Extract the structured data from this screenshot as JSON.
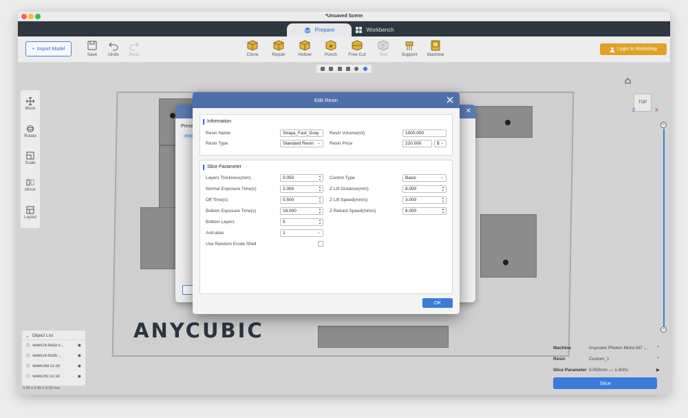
{
  "window": {
    "title": "*Unsaved Scene"
  },
  "tabs": [
    {
      "label": "Prepare"
    },
    {
      "label": "Workbench"
    }
  ],
  "toolbar": {
    "import_label": "Import Model",
    "left_items": [
      {
        "label": "Save",
        "icon": "save-icon"
      },
      {
        "label": "Undo",
        "icon": "undo-icon"
      },
      {
        "label": "Redo",
        "icon": "redo-icon"
      }
    ],
    "center_items": [
      {
        "label": "Clone",
        "icon": "clone-icon"
      },
      {
        "label": "Repair",
        "icon": "repair-icon"
      },
      {
        "label": "Hollow",
        "icon": "hollow-icon"
      },
      {
        "label": "Punch",
        "icon": "punch-icon"
      },
      {
        "label": "Free Cut",
        "icon": "free-cut-icon"
      },
      {
        "label": "Text",
        "icon": "text-icon"
      },
      {
        "label": "Support",
        "icon": "support-icon"
      },
      {
        "label": "Machine",
        "icon": "machine-icon"
      }
    ],
    "login_label": "Login to Workshop"
  },
  "left_tools": [
    {
      "label": "Move",
      "icon": "move-icon"
    },
    {
      "label": "Rotate",
      "icon": "rotate-icon"
    },
    {
      "label": "Scale",
      "icon": "scale-icon"
    },
    {
      "label": "Mirror",
      "icon": "mirror-icon"
    },
    {
      "label": "Layout",
      "icon": "layout-icon"
    }
  ],
  "viewport": {
    "brand_text": "ANYCUBIC",
    "nav_cube": "TOP",
    "axis_z": "Z",
    "axis_x": "X"
  },
  "object_list": {
    "title": "Object List",
    "items": [
      "week16-testa v...",
      "week16-testb ...",
      "week16d v2.stl",
      "week16c v2.stl"
    ],
    "dimensions": "0.00 x 0.00 x 0.00 mm"
  },
  "right_panel": {
    "machine_label": "Machine",
    "machine_value": "Anycubic Photon Mono M7 ...",
    "resin_label": "Resin",
    "resin_value": "Custom_1",
    "slice_param_label": "Slice Parameter",
    "slice_param_value": "0.050mm",
    "slice_param_time": "1.800s",
    "slice_button": "Slice"
  },
  "preset_dialog": {
    "label": "Prese",
    "tag": "Anyc"
  },
  "edit_resin": {
    "title": "Edit Resin",
    "info_title": "Information",
    "resin_name_label": "Resin Name",
    "resin_name": "Siraya_Fast_Gray",
    "resin_type_label": "Resin Type",
    "resin_type": "Standard Resin",
    "resin_volume_label": "Resin Volume(ml)",
    "resin_volume": "1000.000",
    "resin_price_label": "Resin Price",
    "resin_price": "220.000",
    "currency": "$",
    "slice_title": "Slice Parameter",
    "layer_thickness_label": "Layers Thickness(mm)",
    "layer_thickness": "0.050",
    "normal_exposure_label": "Normal Exposure Time(s)",
    "normal_exposure": "2.000",
    "off_time_label": "Off Time(s)",
    "off_time": "0.500",
    "bottom_exposure_label": "Bottom Exposure Time(s)",
    "bottom_exposure": "18.000",
    "bottom_layers_label": "Bottom Layers",
    "bottom_layers": "5",
    "anti_alias_label": "Anti-alias",
    "anti_alias": "1",
    "erode_label": "Use Random Erode Shell",
    "control_type_label": "Control Type",
    "control_type": "Basic",
    "z_lift_distance_label": "Z Lift Distance(mm)",
    "z_lift_distance": "8.000",
    "z_lift_speed_label": "Z Lift Speed(mm/s)",
    "z_lift_speed": "3.000",
    "z_retract_speed_label": "Z Retract Speed(mm/s)",
    "z_retract_speed": "6.000",
    "ok_label": "OK"
  }
}
